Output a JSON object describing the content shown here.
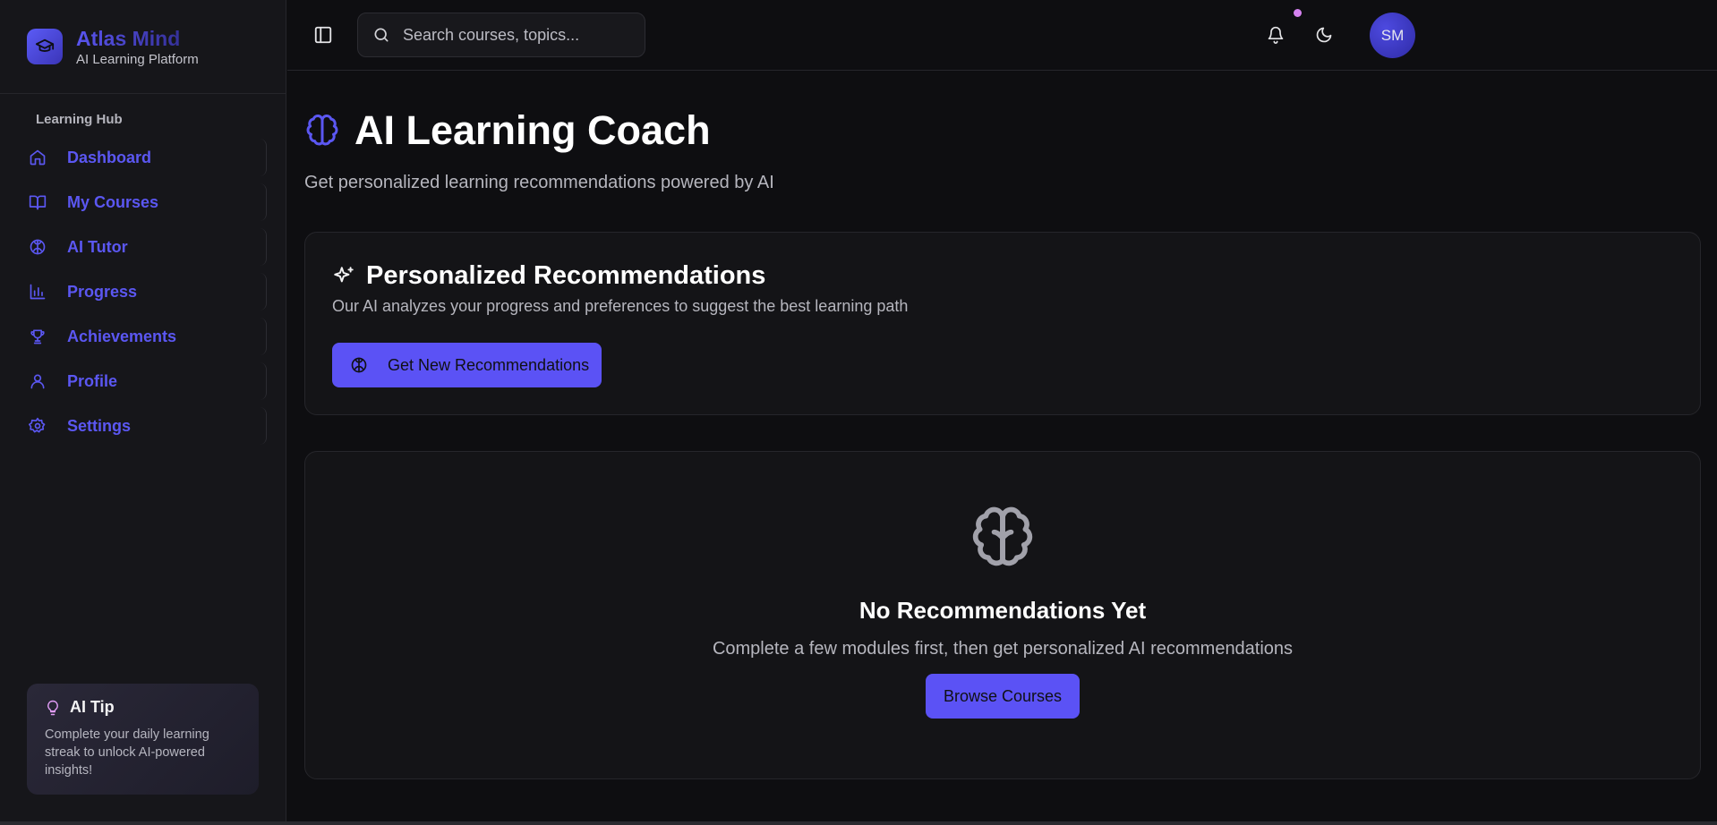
{
  "brand": {
    "name": "Atlas Mind",
    "subtitle": "AI Learning Platform",
    "icon": "graduation-cap-icon"
  },
  "sidebar": {
    "group_label": "Learning Hub",
    "items": [
      {
        "label": "Dashboard",
        "icon": "home-icon"
      },
      {
        "label": "My Courses",
        "icon": "book-open-icon"
      },
      {
        "label": "AI Tutor",
        "icon": "brain-icon"
      },
      {
        "label": "Progress",
        "icon": "bar-chart-icon"
      },
      {
        "label": "Achievements",
        "icon": "trophy-icon"
      },
      {
        "label": "Profile",
        "icon": "user-icon"
      },
      {
        "label": "Settings",
        "icon": "gear-icon"
      }
    ],
    "tip": {
      "title": "AI Tip",
      "body": "Complete your daily learning streak to unlock AI-powered insights!",
      "icon": "lightbulb-icon"
    }
  },
  "header": {
    "search_placeholder": "Search courses, topics...",
    "avatar_initials": "SM",
    "notification_dot_color": "#d582f0"
  },
  "main": {
    "title": "AI Learning Coach",
    "subtitle": "Get personalized learning recommendations powered by AI",
    "recommendations": {
      "title": "Personalized Recommendations",
      "description": "Our AI analyzes your progress and preferences to suggest the best learning path",
      "button_label": "Get New Recommendations"
    },
    "empty_state": {
      "title": "No Recommendations Yet",
      "description": "Complete a few modules first, then get personalized AI recommendations",
      "button_label": "Browse Courses"
    }
  },
  "colors": {
    "accent": "#5b52f5",
    "background": "#0e0e11",
    "sidebar": "#16161a",
    "card": "#141417"
  }
}
